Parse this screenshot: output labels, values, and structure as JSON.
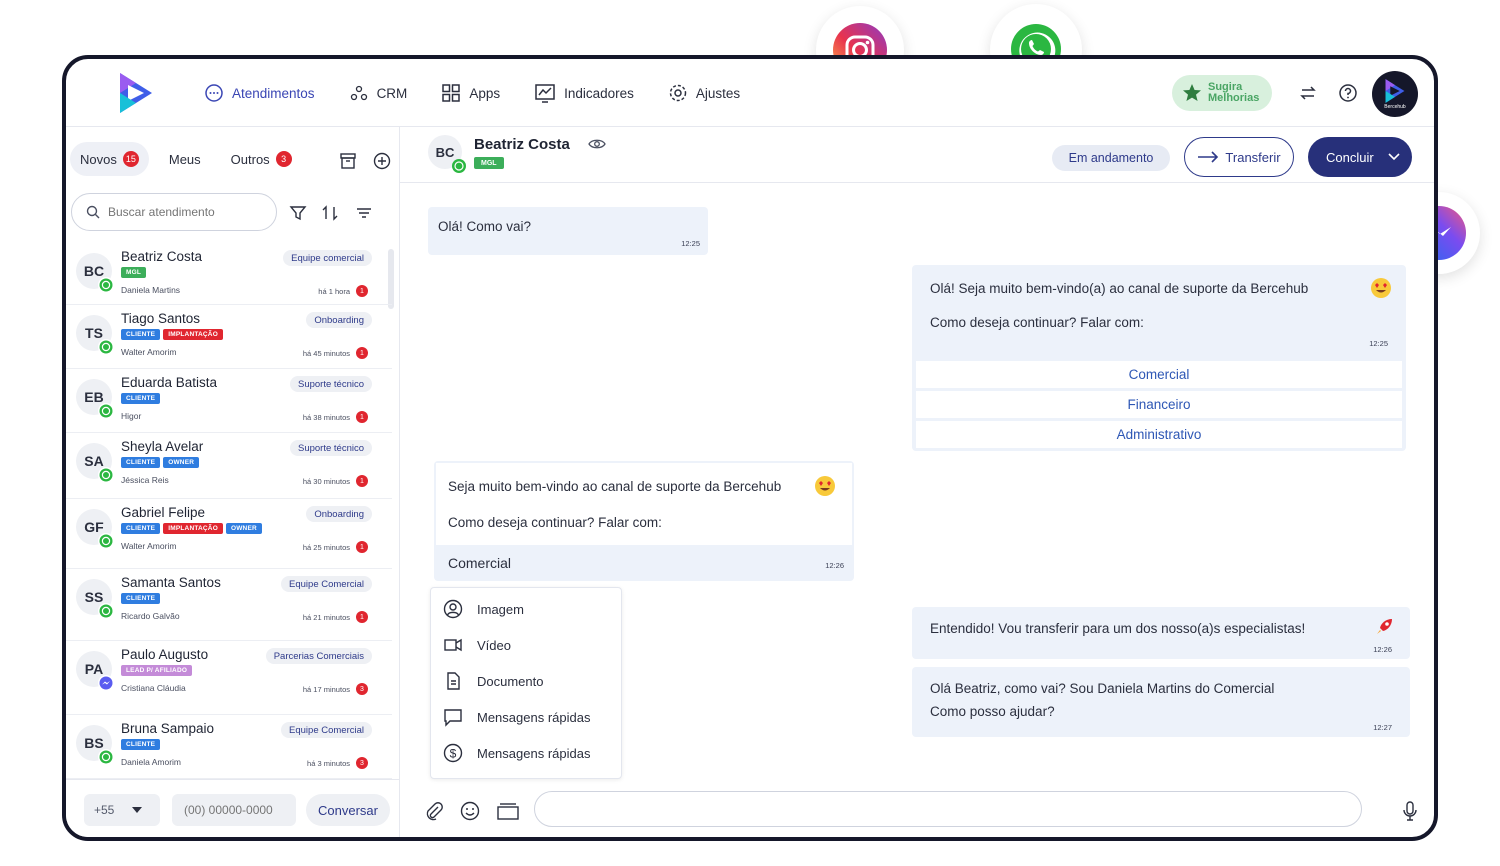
{
  "nav": {
    "items": [
      {
        "label": "Atendimentos",
        "icon": "chat-bubble-icon"
      },
      {
        "label": "CRM",
        "icon": "flow-icon"
      },
      {
        "label": "Apps",
        "icon": "grid-icon"
      },
      {
        "label": "Indicadores",
        "icon": "chart-icon"
      },
      {
        "label": "Ajustes",
        "icon": "gear-icon"
      }
    ],
    "sugira_line1": "Sugira",
    "sugira_line2": "Melhorias",
    "avatar_label": "Bercehub"
  },
  "tabs": {
    "novos": "Novos",
    "novos_count": "15",
    "meus": "Meus",
    "outros": "Outros",
    "outros_count": "3"
  },
  "search": {
    "placeholder": "Buscar atendimento"
  },
  "contacts": [
    {
      "initials": "BC",
      "name": "Beatriz Costa",
      "tags": [
        {
          "t": "MGL",
          "c": "#3cae5a"
        }
      ],
      "agent": "Daniela Martins",
      "team": "Equipe comercial",
      "time": "há 1 hora",
      "count": "1",
      "channel": "whatsapp"
    },
    {
      "initials": "TS",
      "name": "Tiago Santos",
      "tags": [
        {
          "t": "CLIENTE",
          "c": "#2f7de0"
        },
        {
          "t": "IMPLANTAÇÃO",
          "c": "#e0262f"
        }
      ],
      "agent": "Walter Amorim",
      "team": "Onboarding",
      "time": "há 45 minutos",
      "count": "1",
      "channel": "whatsapp"
    },
    {
      "initials": "EB",
      "name": "Eduarda Batista",
      "tags": [
        {
          "t": "CLIENTE",
          "c": "#2f7de0"
        }
      ],
      "agent": "Higor",
      "team": "Suporte técnico",
      "time": "há 38 minutos",
      "count": "1",
      "channel": "whatsapp"
    },
    {
      "initials": "SA",
      "name": "Sheyla Avelar",
      "tags": [
        {
          "t": "CLIENTE",
          "c": "#2f7de0"
        },
        {
          "t": "OWNER",
          "c": "#2f7de0"
        }
      ],
      "agent": "Jéssica Reis",
      "team": "Suporte técnico",
      "time": "há 30 minutos",
      "count": "1",
      "channel": "whatsapp"
    },
    {
      "initials": "GF",
      "name": "Gabriel Felipe",
      "tags": [
        {
          "t": "CLIENTE",
          "c": "#2f7de0"
        },
        {
          "t": "IMPLANTAÇÃO",
          "c": "#e0262f"
        },
        {
          "t": "OWNER",
          "c": "#2f7de0"
        }
      ],
      "agent": "Walter Amorim",
      "team": "Onboarding",
      "time": "há 25 minutos",
      "count": "1",
      "channel": "whatsapp"
    },
    {
      "initials": "SS",
      "name": "Samanta Santos",
      "tags": [
        {
          "t": "CLIENTE",
          "c": "#2f7de0"
        }
      ],
      "agent": "Ricardo Galvão",
      "team": "Equipe Comercial",
      "time": "há 21 minutos",
      "count": "1",
      "channel": "whatsapp"
    },
    {
      "initials": "PA",
      "name": "Paulo Augusto",
      "tags": [
        {
          "t": "LEAD P/ AFILIADO",
          "c": "#c48bd8"
        }
      ],
      "agent": "Cristiana Cláudia",
      "team": "Parcerias Comerciais",
      "time": "há 17 minutos",
      "count": "3",
      "channel": "messenger"
    },
    {
      "initials": "BS",
      "name": "Bruna Sampaio",
      "tags": [
        {
          "t": "CLIENTE",
          "c": "#2f7de0"
        }
      ],
      "agent": "Daniela Amorim",
      "team": "Equipe Comercial",
      "time": "há 3 minutos",
      "count": "3",
      "channel": "whatsapp"
    }
  ],
  "bottom": {
    "ddi": "+55",
    "phone_placeholder": "(00) 00000-0000",
    "button": "Conversar"
  },
  "chat": {
    "initials": "BC",
    "name": "Beatriz Costa",
    "tag": "MGL",
    "status": "Em andamento",
    "transfer": "Transferir",
    "conclude": "Concluir"
  },
  "messages": {
    "m1": {
      "text": "Olá! Como vai?",
      "time": "12:25"
    },
    "m2": {
      "line1": "Olá! Seja muito bem-vindo(a) ao canal de suporte da Bercehub",
      "line2": "Como deseja continuar? Falar com:",
      "time": "12:25",
      "options": [
        "Comercial",
        "Financeiro",
        "Administrativo"
      ]
    },
    "m3": {
      "line1": "Seja muito bem-vindo ao canal de suporte da Bercehub",
      "line2": "Como deseja continuar? Falar com:",
      "reply": "Comercial",
      "time": "12:26"
    },
    "m4": {
      "text": "Entendido! Vou transferir para um dos nosso(a)s especialistas!",
      "time": "12:26"
    },
    "m5": {
      "line1": "Olá Beatriz, como vai? Sou Daniela Martins do Comercial",
      "line2": "Como posso ajudar?",
      "time": "12:27"
    }
  },
  "attach_menu": [
    {
      "label": "Imagem",
      "icon": "user-circle-icon"
    },
    {
      "label": "Vídeo",
      "icon": "video-icon"
    },
    {
      "label": "Documento",
      "icon": "document-icon"
    },
    {
      "label": "Mensagens rápidas",
      "icon": "quick-message-icon"
    },
    {
      "label": "Mensagens rápidas",
      "icon": "dollar-icon"
    }
  ],
  "colors": {
    "primary": "#27307a",
    "accent": "#3a46b4",
    "badge": "#e0262f",
    "bubble": "#edf2fa"
  }
}
